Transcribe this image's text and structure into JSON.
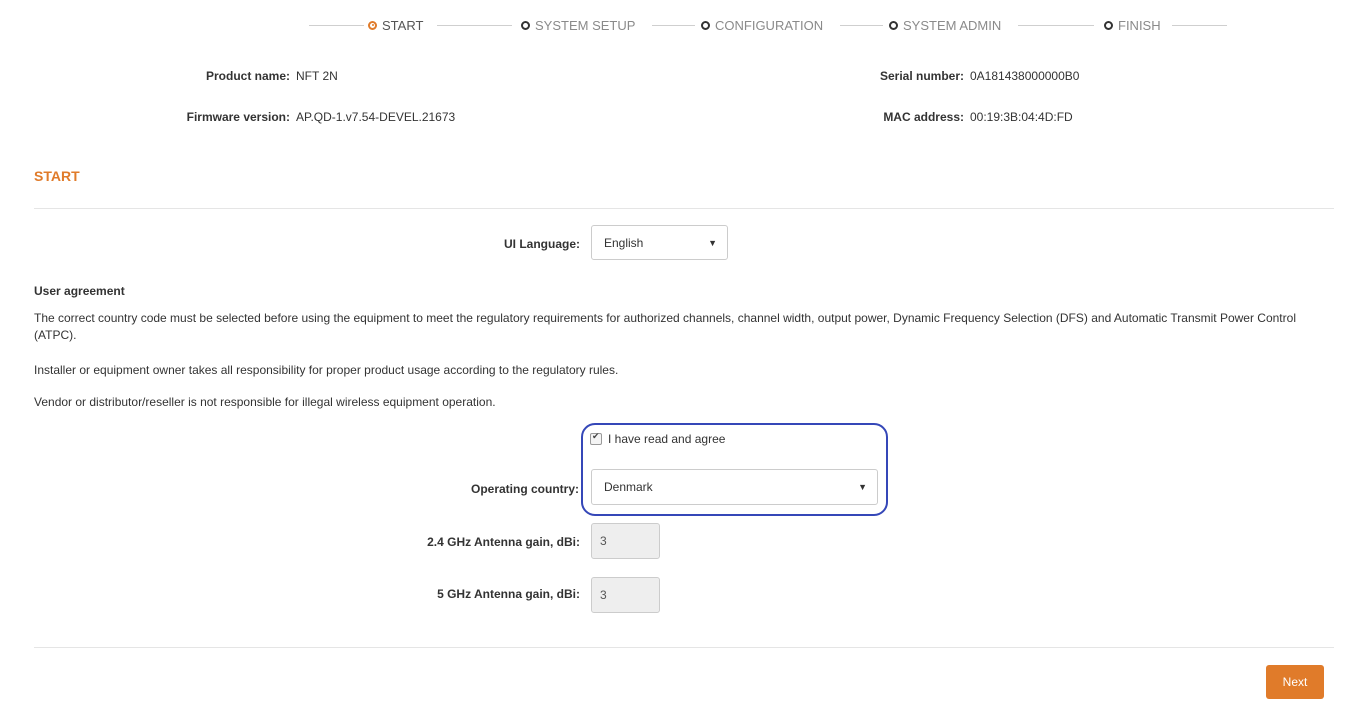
{
  "wizard": {
    "steps": [
      {
        "label": "START",
        "active": true
      },
      {
        "label": "SYSTEM SETUP",
        "active": false
      },
      {
        "label": "CONFIGURATION",
        "active": false
      },
      {
        "label": "SYSTEM ADMIN",
        "active": false
      },
      {
        "label": "FINISH",
        "active": false
      }
    ]
  },
  "device": {
    "product_name_label": "Product name:",
    "product_name": "NFT 2N",
    "firmware_label": "Firmware version:",
    "firmware": "AP.QD-1.v7.54-DEVEL.21673",
    "serial_label": "Serial number:",
    "serial": "0A181438000000B0",
    "mac_label": "MAC address:",
    "mac": "00:19:3B:04:4D:FD"
  },
  "section": {
    "title": "START"
  },
  "ui_language": {
    "label": "UI Language:",
    "value": "English"
  },
  "agreement": {
    "title": "User agreement",
    "p1": "The correct country code must be selected before using the equipment to meet the regulatory requirements for authorized channels, channel width, output power, Dynamic Frequency Selection (DFS) and Automatic Transmit Power Control (ATPC).",
    "p2": "Installer or equipment owner takes all responsibility for proper product usage according to the regulatory rules.",
    "p3": "Vendor or distributor/reseller is not responsible for illegal wireless equipment operation.",
    "checkbox_label": "I have read and agree",
    "checked": true
  },
  "country": {
    "label": "Operating country:",
    "value": "Denmark"
  },
  "antenna_24": {
    "label": "2.4 GHz Antenna gain, dBi:",
    "value": "3"
  },
  "antenna_5": {
    "label": "5 GHz Antenna gain, dBi:",
    "value": "3"
  },
  "actions": {
    "next_label": "Next"
  },
  "colors": {
    "accent": "#e07b2a",
    "highlight": "#3547b8"
  }
}
